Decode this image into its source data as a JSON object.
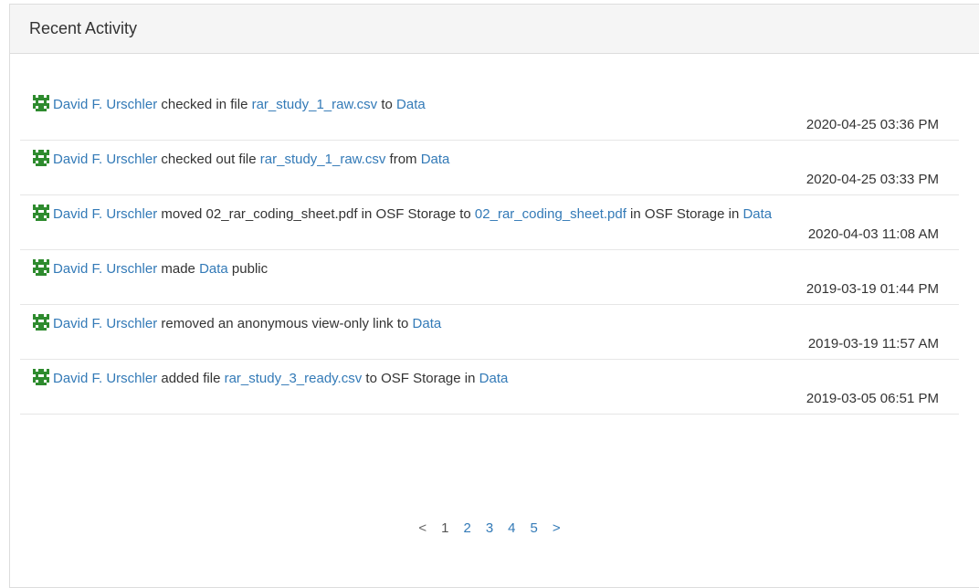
{
  "panel": {
    "title": "Recent Activity"
  },
  "logs": [
    {
      "user": "David F. Urschler",
      "parts": [
        " checked in file ",
        {
          "link": "rar_study_1_raw.csv"
        },
        " to ",
        {
          "link": "Data"
        }
      ],
      "time": "2020-04-25 03:36 PM"
    },
    {
      "user": "David F. Urschler",
      "parts": [
        " checked out file ",
        {
          "link": "rar_study_1_raw.csv"
        },
        " from ",
        {
          "link": "Data"
        }
      ],
      "time": "2020-04-25 03:33 PM"
    },
    {
      "user": "David F. Urschler",
      "parts": [
        " moved 02_rar_coding_sheet.pdf in OSF Storage to ",
        {
          "link": "02_rar_coding_sheet.pdf"
        },
        " in OSF Storage in ",
        {
          "link": "Data"
        }
      ],
      "time": "2020-04-03 11:08 AM"
    },
    {
      "user": "David F. Urschler",
      "parts": [
        " made ",
        {
          "link": "Data"
        },
        " public"
      ],
      "time": "2019-03-19 01:44 PM"
    },
    {
      "user": "David F. Urschler",
      "parts": [
        " removed an anonymous view-only link to ",
        {
          "link": "Data"
        }
      ],
      "time": "2019-03-19 11:57 AM"
    },
    {
      "user": "David F. Urschler",
      "parts": [
        " added file ",
        {
          "link": "rar_study_3_ready.csv"
        },
        " to OSF Storage in ",
        {
          "link": "Data"
        }
      ],
      "time": "2019-03-05 06:51 PM"
    }
  ],
  "pager": {
    "prev": "<",
    "pages": [
      "1",
      "2",
      "3",
      "4",
      "5"
    ],
    "next": ">",
    "current": "1"
  },
  "colors": {
    "link": "#337ab7",
    "avatar": "#2e8b2e"
  },
  "icons": {
    "avatar": "identicon-avatar-icon"
  }
}
